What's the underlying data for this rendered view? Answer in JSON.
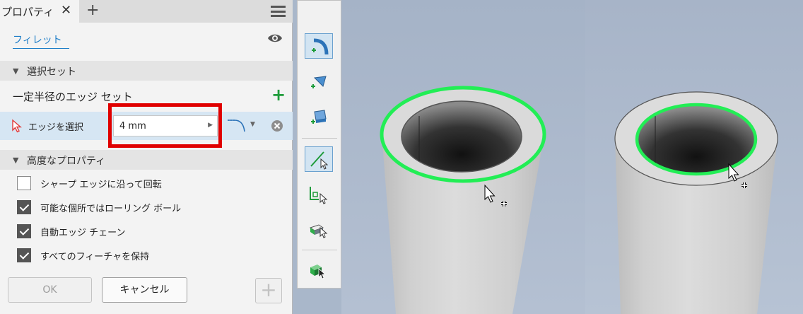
{
  "panel": {
    "tab_label": "プロパティ",
    "tab_close": "✕",
    "tab_add": "+",
    "feature_name": "フィレット",
    "sections": {
      "selection_set": "選択セット",
      "advanced": "高度なプロパティ"
    },
    "edge_set_label": "一定半径のエッジ セット",
    "add_glyph": "+",
    "edge_row": {
      "label": "エッジを選択",
      "radius_value": "4 mm"
    },
    "options": [
      {
        "label": "シャープ エッジに沿って回転",
        "checked": false
      },
      {
        "label": "可能な個所ではローリング ボール",
        "checked": true
      },
      {
        "label": "自動エッジ チェーン",
        "checked": true
      },
      {
        "label": "すべてのフィーチャを保持",
        "checked": true
      }
    ],
    "buttons": {
      "ok": "OK",
      "cancel": "キャンセル",
      "apply_plus": "+"
    }
  },
  "colors": {
    "accent": "#1d7dc7",
    "highlight": "#e00000",
    "add_green": "#1f9c3b",
    "edge_selection": "#22ee55"
  },
  "toolbar": {
    "tools": [
      "constant-radius-fillet-icon",
      "variable-fillet-icon",
      "setback-fillet-icon",
      "edge-select-mode-icon",
      "loop-select-mode-icon",
      "feature-select-mode-icon",
      "all-edges-select-icon"
    ]
  }
}
